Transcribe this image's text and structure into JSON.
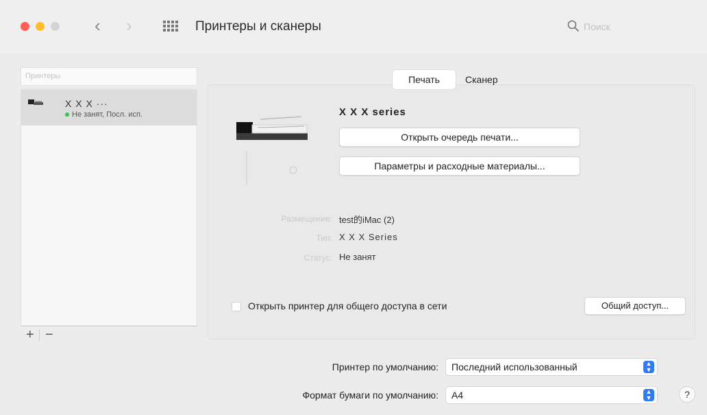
{
  "window": {
    "title": "Принтеры и сканеры",
    "search_placeholder": "Поиск"
  },
  "sidebar": {
    "search_placeholder": "Принтеры",
    "printers": [
      {
        "name": "X X X  ···",
        "status": "Не занят, Посл. исп."
      }
    ],
    "add_label": "+",
    "remove_label": "−"
  },
  "tabs": [
    {
      "label": "Печать",
      "selected": true
    },
    {
      "label": "Сканер",
      "selected": false
    }
  ],
  "printer": {
    "name": "X X X  series",
    "open_queue_label": "Открыть очередь печати...",
    "options_label": "Параметры и расходные материалы...",
    "location_label": "Размещение:",
    "location_value": "test的iMac (2)",
    "kind_label": "Тип:",
    "kind_value": "X X X   Series",
    "status_label": "Статус:",
    "status_value": "Не занят"
  },
  "sharing": {
    "checkbox_label": "Открыть принтер для общего доступа в сети",
    "checked": false,
    "button_label": "Общий доступ..."
  },
  "defaults": {
    "printer_label": "Принтер по умолчанию:",
    "printer_value": "Последний использованный",
    "paper_label": "Формат бумаги по умолчанию:",
    "paper_value": "A4"
  },
  "help_label": "?",
  "colors": {
    "accent": "#2f7cf6",
    "status_green": "#3cc24a",
    "close_red": "#fe5f57",
    "minimize_yellow": "#febc2e"
  }
}
